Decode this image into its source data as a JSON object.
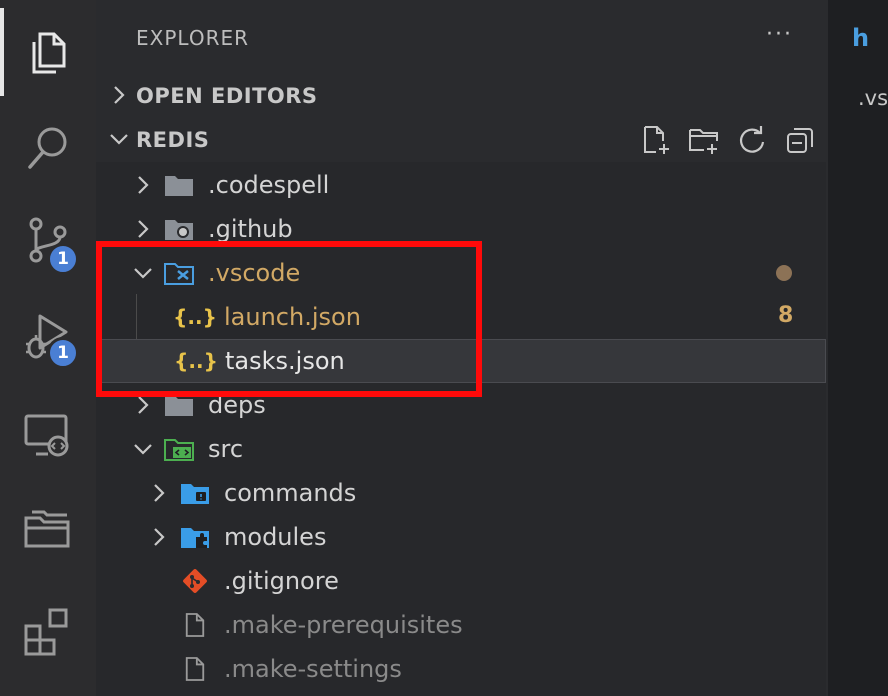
{
  "activity": {
    "scm_badge": "1",
    "debug_badge": "1"
  },
  "sidebar": {
    "title": "EXPLORER",
    "more": "···",
    "open_editors": "OPEN EDITORS",
    "workspace": "REDIS"
  },
  "tree": {
    "codespell": ".codespell",
    "github": ".github",
    "vscode": ".vscode",
    "launch": "launch.json",
    "launch_problems": "8",
    "tasks": "tasks.json",
    "deps": "deps",
    "src": "src",
    "commands": "commands",
    "modules": "modules",
    "gitignore": ".gitignore",
    "make_prereq": ".make-prerequisites",
    "make_settings": ".make-settings"
  },
  "json_icon": "{..}",
  "editor": {
    "tab_letter": "h",
    "breadcrumb": ".vs"
  },
  "colors": {
    "folder": "#8b9097",
    "modified": "#d2a965",
    "accent": "#4a7fd4",
    "highlight": "#ff0a0a"
  }
}
